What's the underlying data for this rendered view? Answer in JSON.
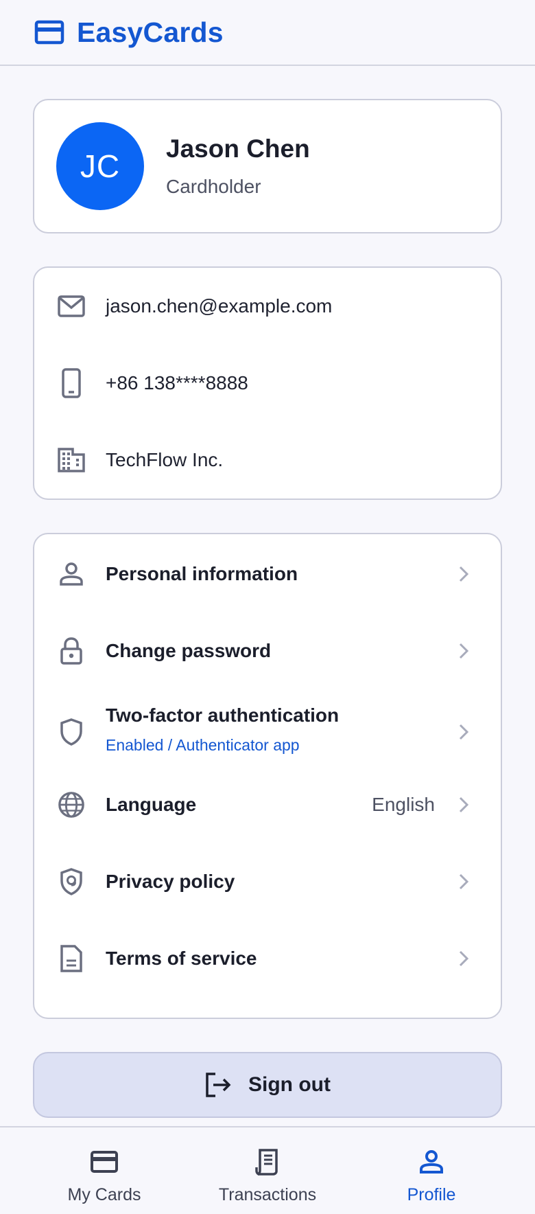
{
  "app": {
    "brand": "EasyCards",
    "accent_color": "#1457d1"
  },
  "profile": {
    "initials": "JC",
    "name": "Jason Chen",
    "role": "Cardholder",
    "avatar_color": "#0b66f4"
  },
  "contact": {
    "email": "jason.chen@example.com",
    "phone": "+86 138****8888",
    "company": "TechFlow Inc."
  },
  "menu": {
    "items": [
      {
        "label": "Personal information",
        "icon": "person-icon"
      },
      {
        "label": "Change password",
        "icon": "lock-icon"
      },
      {
        "label": "Two-factor authentication",
        "sublabel": "Enabled / Authenticator app",
        "icon": "shield-icon"
      },
      {
        "label": "Language",
        "value": "English",
        "icon": "globe-icon"
      },
      {
        "label": "Privacy policy",
        "icon": "privacy-shield-icon"
      },
      {
        "label": "Terms of service",
        "icon": "document-icon"
      }
    ]
  },
  "signout": {
    "label": "Sign out"
  },
  "bottom_nav": {
    "items": [
      {
        "label": "My Cards",
        "icon": "card-icon"
      },
      {
        "label": "Transactions",
        "icon": "receipt-icon"
      },
      {
        "label": "Profile",
        "icon": "person-icon",
        "active": true
      }
    ]
  }
}
